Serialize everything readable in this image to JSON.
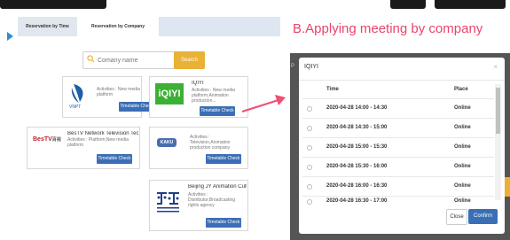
{
  "tabs": {
    "by_time": "Reservation by Time",
    "by_company": "Reservation by Company"
  },
  "search": {
    "placeholder": "Comany name",
    "button": "Search"
  },
  "cards": [
    {
      "logo": "VNPT",
      "name": "",
      "activities": "Activities : New media platform",
      "button": "Timetable Check"
    },
    {
      "logo": "iQIYI",
      "name": "IQIYI",
      "activities": "Activities : New media platform,Animation production...",
      "button": "Timetable Check"
    },
    {
      "logo": "BesTV",
      "name": "BesTV Network Television Tech...",
      "activities": "Activities : Platform,New media platform",
      "button": "Timetable Check"
    },
    {
      "logo": "KAKU",
      "name": "",
      "activities": "Activities : Television,Animation production company",
      "button": "Timetable Check"
    },
    {
      "logo": "JY",
      "name": "Beijing JY Animation Culture C...",
      "activities": "Activities : Distributor,Broadcasting rights agency",
      "button": "Timetable Check"
    }
  ],
  "right_title": "B.Applying meeting by company",
  "modal": {
    "title": "IQIYI",
    "columns": {
      "time": "Time",
      "place": "Place"
    },
    "rows": [
      {
        "time": "2020-04-28 14:00 - 14:30",
        "place": "Online"
      },
      {
        "time": "2020-04-28 14:30 - 15:00",
        "place": "Online"
      },
      {
        "time": "2020-04-28 15:00 - 15:30",
        "place": "Online"
      },
      {
        "time": "2020-04-28 15:30 - 16:00",
        "place": "Online"
      },
      {
        "time": "2020-04-28 16:00 - 16:30",
        "place": "Online"
      },
      {
        "time": "2020-04-28 16:30 - 17:00",
        "place": "Online"
      }
    ],
    "close_button": "Close",
    "confirm_button": "Confirm"
  },
  "colors": {
    "accent_blue": "#3b6fb5",
    "search_orange": "#e9b135",
    "title_pink": "#e9446a",
    "arrow_pink": "#ef4f73"
  }
}
